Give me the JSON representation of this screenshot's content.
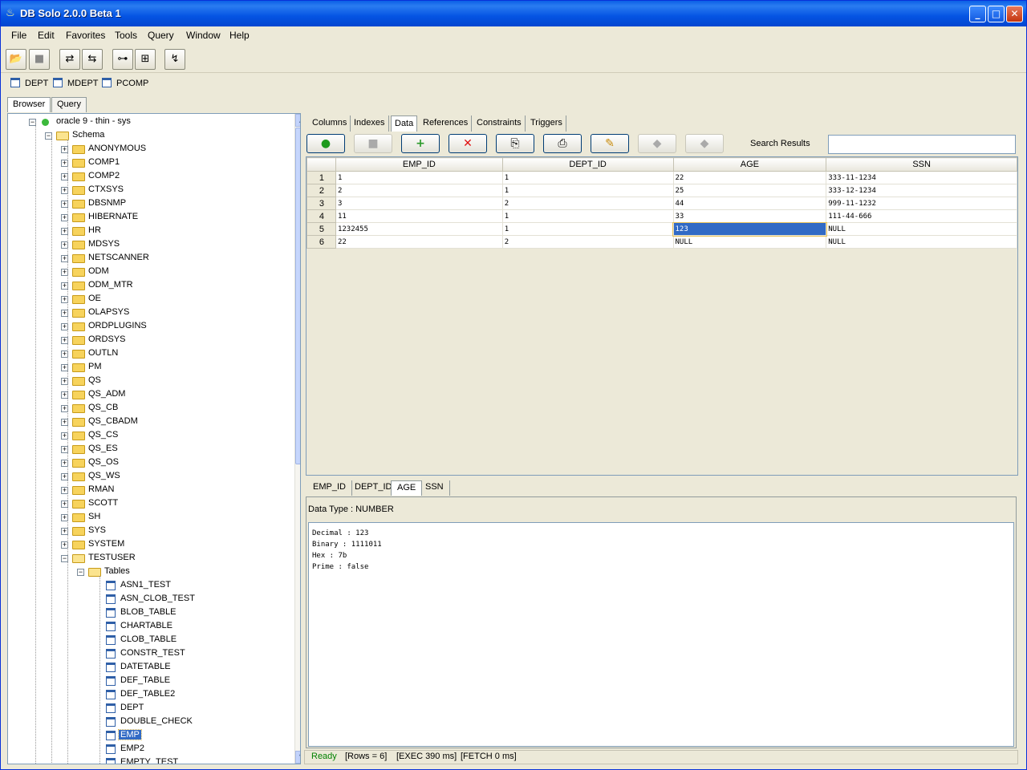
{
  "window": {
    "title": "DB Solo  2.0.0 Beta 1"
  },
  "menu": [
    "File",
    "Edit",
    "Favorites",
    "Tools",
    "Query",
    "Window",
    "Help"
  ],
  "toolbar_icons": [
    "open-icon",
    "stop-icon",
    "connect-icon",
    "disconnect-icon",
    "schema-icon",
    "grid-icon",
    "explain-icon"
  ],
  "favorites": [
    "DEPT",
    "MDEPT",
    "PCOMP"
  ],
  "left_tabs": [
    "Browser",
    "Query"
  ],
  "tree": {
    "connection": "oracle 9 - thin - sys",
    "schema_label": "Schema",
    "schemas": [
      "ANONYMOUS",
      "COMP1",
      "COMP2",
      "CTXSYS",
      "DBSNMP",
      "HIBERNATE",
      "HR",
      "MDSYS",
      "NETSCANNER",
      "ODM",
      "ODM_MTR",
      "OE",
      "OLAPSYS",
      "ORDPLUGINS",
      "ORDSYS",
      "OUTLN",
      "PM",
      "QS",
      "QS_ADM",
      "QS_CB",
      "QS_CBADM",
      "QS_CS",
      "QS_ES",
      "QS_OS",
      "QS_WS",
      "RMAN",
      "SCOTT",
      "SH",
      "SYS",
      "SYSTEM",
      "TESTUSER"
    ],
    "tables_label": "Tables",
    "tables": [
      "ASN1_TEST",
      "ASN_CLOB_TEST",
      "BLOB_TABLE",
      "CHARTABLE",
      "CLOB_TABLE",
      "CONSTR_TEST",
      "DATETABLE",
      "DEF_TABLE",
      "DEF_TABLE2",
      "DEPT",
      "DOUBLE_CHECK",
      "EMP",
      "EMP2",
      "EMPTY_TEST"
    ],
    "selected_table": "EMP"
  },
  "right_tabs": [
    "Columns",
    "Indexes",
    "Data",
    "References",
    "Constraints",
    "Triggers"
  ],
  "active_right_tab": "Data",
  "search": {
    "label": "Search Results",
    "value": ""
  },
  "grid": {
    "columns": [
      "EMP_ID",
      "DEPT_ID",
      "AGE",
      "SSN"
    ],
    "rows": [
      {
        "n": "1",
        "cells": [
          "1",
          "1",
          "22",
          "333-11-1234"
        ]
      },
      {
        "n": "2",
        "cells": [
          "2",
          "1",
          "25",
          "333-12-1234"
        ]
      },
      {
        "n": "3",
        "cells": [
          "3",
          "2",
          "44",
          "999-11-1232"
        ]
      },
      {
        "n": "4",
        "cells": [
          "11",
          "1",
          "33",
          "111-44-666"
        ]
      },
      {
        "n": "5",
        "cells": [
          "1232455",
          "1",
          "123",
          "NULL"
        ]
      },
      {
        "n": "6",
        "cells": [
          "22",
          "2",
          "NULL",
          "NULL"
        ]
      }
    ],
    "selected": {
      "row": 4,
      "col": 2
    }
  },
  "bottom_tabs": [
    "EMP_ID",
    "DEPT_ID",
    "AGE",
    "SSN"
  ],
  "detail": {
    "data_type": "Data Type : NUMBER",
    "lines": [
      "Decimal : 123",
      "Binary : 1111011",
      "Hex : 7b",
      "Prime : false"
    ]
  },
  "status": {
    "ready": "Ready",
    "rows": "[Rows = 6]",
    "exec": "[EXEC 390 ms]",
    "fetch": "[FETCH 0 ms]",
    "ready_color": "#008000"
  }
}
